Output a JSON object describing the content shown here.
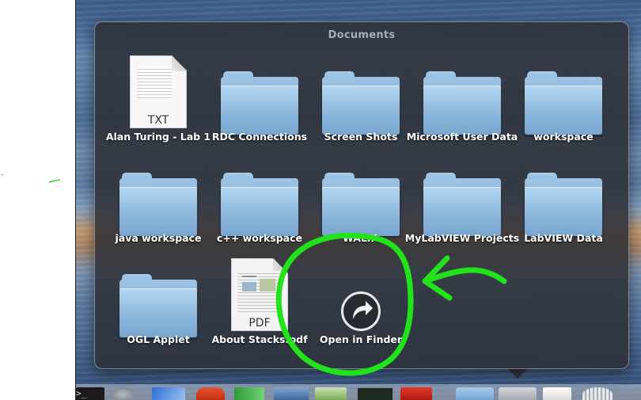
{
  "stack": {
    "title": "Documents",
    "items": [
      {
        "label": "Alan Turing - Lab 1",
        "type": "txt-document",
        "ext": "TXT"
      },
      {
        "label": "RDC Connections",
        "type": "folder"
      },
      {
        "label": "Screen Shots",
        "type": "folder"
      },
      {
        "label": "Microsoft User Data",
        "type": "folder"
      },
      {
        "label": "workspace",
        "type": "folder"
      },
      {
        "label": "java workspace",
        "type": "folder"
      },
      {
        "label": "c++ workspace",
        "type": "folder"
      },
      {
        "label": "WALTA",
        "type": "folder"
      },
      {
        "label": "MyLabVIEW Projects",
        "type": "folder"
      },
      {
        "label": "LabVIEW Data",
        "type": "folder"
      },
      {
        "label": "OGL Applet",
        "type": "folder"
      },
      {
        "label": "About Stacks.pdf",
        "type": "pdf-document",
        "ext": "PDF"
      },
      {
        "label": "Open in Finder",
        "type": "action"
      }
    ]
  },
  "annotation": {
    "color": "#22e21a",
    "shapes": [
      "circle",
      "arrow"
    ]
  },
  "dock": {
    "icons": [
      "terminal-icon",
      "system-prefs-icon",
      "word-icon",
      "powerpoint-icon",
      "excel-icon",
      "xcode-icon",
      "preview-icon",
      "activity-monitor-icon",
      "acrobat-icon",
      "applications-folder-icon",
      "documents-stack-icon",
      "downloads-stack-icon",
      "trash-icon"
    ],
    "terminal_prompt": ">_"
  }
}
